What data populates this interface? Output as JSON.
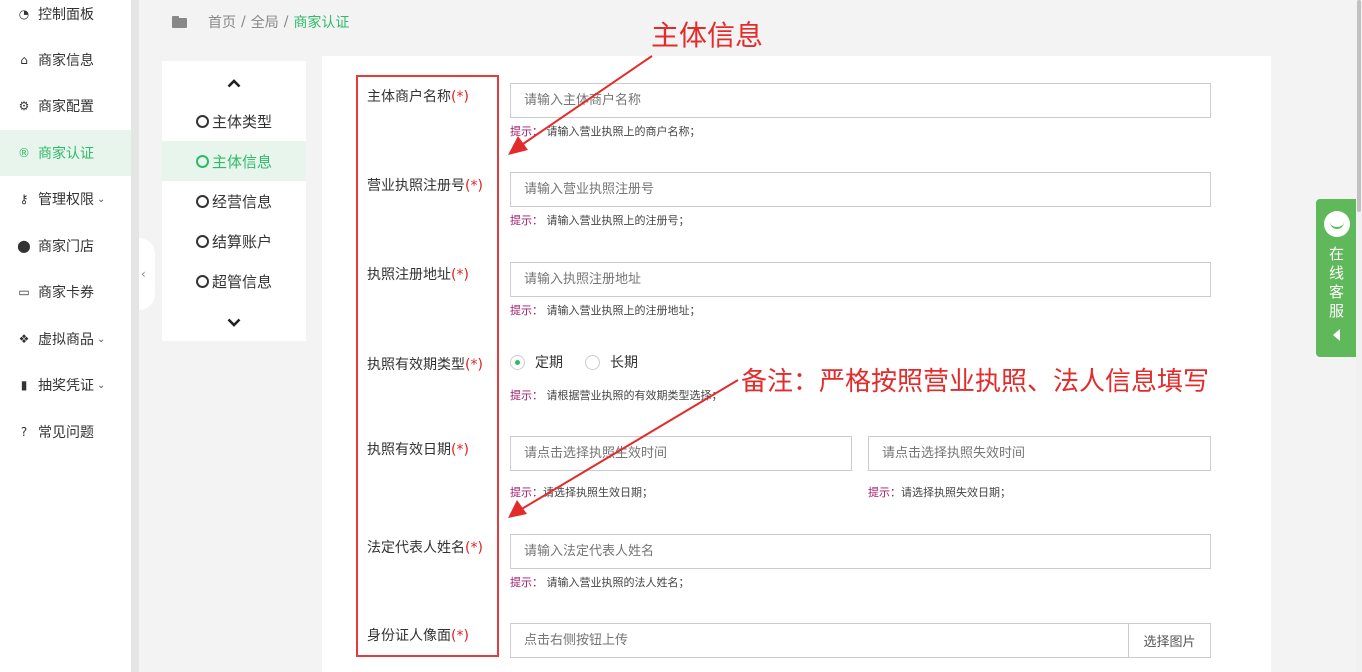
{
  "sidebar": {
    "items": [
      {
        "label": "控制面板",
        "icon": "dashboard-icon",
        "glyph": "◔",
        "has_sub": false,
        "active": false
      },
      {
        "label": "商家信息",
        "icon": "home-icon",
        "glyph": "⌂",
        "has_sub": false,
        "active": false
      },
      {
        "label": "商家配置",
        "icon": "cogs-icon",
        "glyph": "⚙",
        "has_sub": false,
        "active": false
      },
      {
        "label": "商家认证",
        "icon": "registered-icon",
        "glyph": "®",
        "has_sub": false,
        "active": true
      },
      {
        "label": "管理权限",
        "icon": "key-icon",
        "glyph": "⚷",
        "has_sub": true,
        "active": false
      },
      {
        "label": "商家门店",
        "icon": "map-marker-icon",
        "glyph": "⬤",
        "has_sub": false,
        "active": false
      },
      {
        "label": "商家卡券",
        "icon": "credit-card-icon",
        "glyph": "▭",
        "has_sub": false,
        "active": false
      },
      {
        "label": "虚拟商品",
        "icon": "dropbox-icon",
        "glyph": "❖",
        "has_sub": true,
        "active": false
      },
      {
        "label": "抽奖凭证",
        "icon": "bookmark-icon",
        "glyph": "▮",
        "has_sub": true,
        "active": false
      },
      {
        "label": "常见问题",
        "icon": "question-circle-icon",
        "glyph": "?",
        "has_sub": false,
        "active": false
      }
    ],
    "chevron": "⌄",
    "collapse_icon": "‹"
  },
  "breadcrumb": {
    "items": [
      "首页",
      "全局"
    ],
    "separator": "/",
    "current": "商家认证"
  },
  "steps": {
    "items": [
      {
        "label": "主体类型",
        "active": false
      },
      {
        "label": "主体信息",
        "active": true
      },
      {
        "label": "经营信息",
        "active": false
      },
      {
        "label": "结算账户",
        "active": false
      },
      {
        "label": "超管信息",
        "active": false
      }
    ]
  },
  "form": {
    "required_mark": "(*)",
    "hint_key": "提示：",
    "merchant_name": {
      "label": "主体商户名称",
      "placeholder": "请输入主体商户名称",
      "hint": "请输入营业执照上的商户名称；"
    },
    "license_number": {
      "label": "营业执照注册号",
      "placeholder": "请输入营业执照注册号",
      "hint": "请输入营业执照上的注册号；"
    },
    "license_address": {
      "label": "执照注册地址",
      "placeholder": "请输入执照注册地址",
      "hint": "请输入营业执照上的注册地址；"
    },
    "validity_type": {
      "label": "执照有效期类型",
      "options": [
        "定期",
        "长期"
      ],
      "selected": "定期",
      "hint": "请根据营业执照的有效期类型选择；"
    },
    "validity_date": {
      "label": "执照有效日期",
      "start_placeholder": "请点击选择执照生效时间",
      "end_placeholder": "请点击选择执照失效时间",
      "start_hint": "请选择执照生效日期；",
      "end_hint": "请选择执照失效日期；"
    },
    "legal_rep": {
      "label": "法定代表人姓名",
      "placeholder": "请输入法定代表人姓名",
      "hint": "请输入营业执照的法人姓名；"
    },
    "id_front": {
      "label": "身份证人像面",
      "placeholder": "点击右侧按钮上传",
      "button": "选择图片"
    }
  },
  "annotations": {
    "title": "主体信息",
    "note": "备注：严格按照营业执照、法人信息填写",
    "color": "#e32b2b"
  },
  "online_service": {
    "label": "在线客服"
  },
  "colors": {
    "accent": "#2fba6a",
    "required": "#e02222",
    "hint_key": "#a0196b",
    "service": "#5fb85a"
  }
}
